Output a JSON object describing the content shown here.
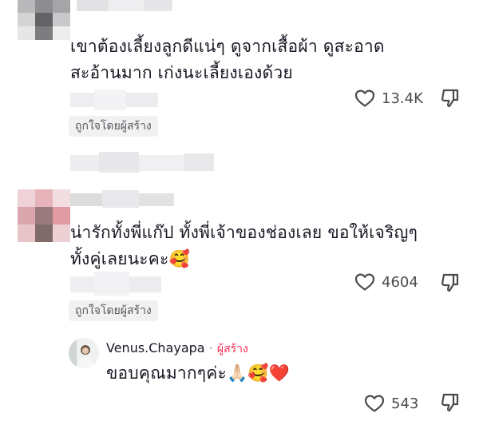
{
  "comments": [
    {
      "text_line1": "เขาต้องเลี้ยงลูกดีแน่ๆ ดูจากเสื้อผ้า ดูสะอาด",
      "text_line2": "สะอ้านมาก เก่งนะเลี้ยงเองด้วย",
      "likes": "13.4K",
      "creator_badge": "ถูกใจโดยผู้สร้าง"
    },
    {
      "text_line1": "น่ารักทั้งพี่แก๊ป ทั้งพี่เจ้าของช่องเลย ขอให้เจริญๆ",
      "text_line2": "ทั้งคู่เลยนะคะ",
      "emoji": "🥰",
      "likes": "4604",
      "creator_badge": "ถูกใจโดยผู้สร้าง"
    }
  ],
  "reply": {
    "username": "Venus.Chayapa",
    "separator": "·",
    "creator_label": "ผู้สร้าง",
    "text": "ขอบคุณมากๆค่ะ",
    "emojis": "🙏🏻🥰❤️",
    "likes": "543"
  },
  "icons": {
    "like": "heart-outline-icon",
    "dislike": "thumbs-down-outline-icon"
  },
  "colors": {
    "text": "#161823",
    "muted": "#55575d",
    "creator": "#fe2c55",
    "badge_bg": "#f1f1f2"
  }
}
